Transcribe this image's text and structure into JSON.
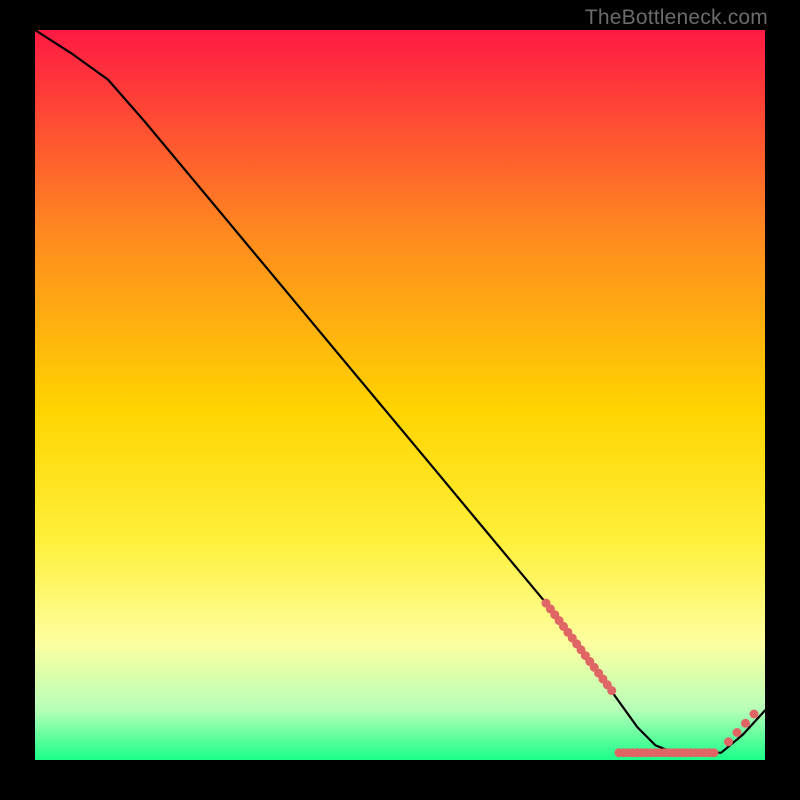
{
  "watermark": "TheBottleneck.com",
  "colors": {
    "top": "#ff1a44",
    "mid_upper": "#ff8a1f",
    "mid": "#ffd400",
    "mid_lower": "#fff03b",
    "pale": "#fdffa0",
    "green_light": "#b8ffb8",
    "green": "#1aff88",
    "curve": "#000000",
    "salmon": "#e06666"
  },
  "chart_data": {
    "type": "line",
    "title": "",
    "xlabel": "",
    "ylabel": "",
    "xlim": [
      0,
      1
    ],
    "ylim": [
      0,
      1
    ],
    "x": [
      0.0,
      0.05,
      0.1,
      0.15,
      0.2,
      0.25,
      0.3,
      0.35,
      0.4,
      0.45,
      0.5,
      0.55,
      0.6,
      0.65,
      0.7,
      0.75,
      0.8,
      0.825,
      0.85,
      0.875,
      0.9,
      0.94,
      0.97,
      1.0
    ],
    "values": [
      1.0,
      0.968,
      0.932,
      0.875,
      0.815,
      0.755,
      0.695,
      0.635,
      0.575,
      0.515,
      0.455,
      0.395,
      0.335,
      0.275,
      0.215,
      0.15,
      0.08,
      0.045,
      0.02,
      0.01,
      0.01,
      0.01,
      0.035,
      0.068
    ],
    "marker_clusters": [
      {
        "x_start": 0.7,
        "x_end": 0.79,
        "y_start": 0.215,
        "y_end": 0.095,
        "count": 16
      },
      {
        "x_start": 0.8,
        "x_end": 0.93,
        "y_fixed": 0.01,
        "count": 22
      },
      {
        "x_start": 0.95,
        "x_end": 0.985,
        "y_start": 0.025,
        "y_end": 0.063,
        "count": 4
      }
    ]
  }
}
